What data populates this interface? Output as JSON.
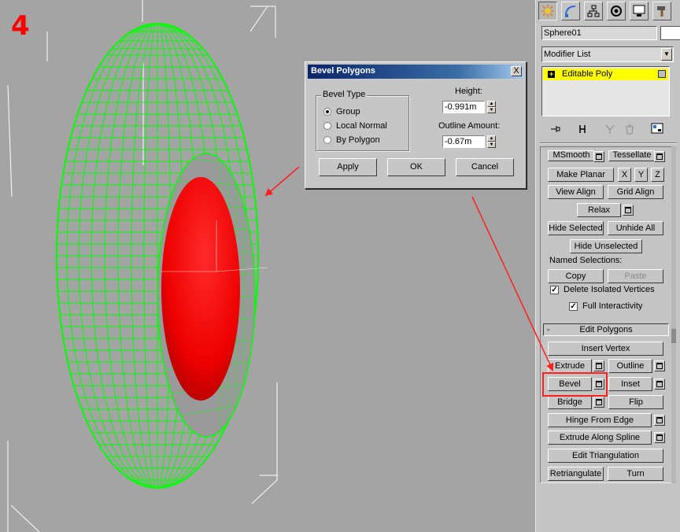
{
  "step_number": "4",
  "dialog": {
    "title": "Bevel Polygons",
    "close": "X",
    "bevel_type_label": "Bevel Type",
    "options": [
      "Group",
      "Local Normal",
      "By Polygon"
    ],
    "selected_option": "Group",
    "height_label": "Height:",
    "height_value": "-0.991m",
    "outline_label": "Outline Amount:",
    "outline_value": "-0.67m",
    "apply": "Apply",
    "ok": "OK",
    "cancel": "Cancel"
  },
  "command_panel": {
    "tabs": [
      "create-icon",
      "modify-icon",
      "hierarchy-icon",
      "motion-icon",
      "display-icon",
      "utilities-icon"
    ],
    "active_tab": "create-icon",
    "object_name": "Sphere01",
    "modifier_list": "Modifier List",
    "stack_item": "Editable Poly",
    "stack_item_plus": "+",
    "buttons": {
      "msmooth": "MSmooth",
      "tessellate": "Tessellate",
      "make_planar": "Make Planar",
      "x": "X",
      "y": "Y",
      "z": "Z",
      "view_align": "View Align",
      "grid_align": "Grid Align",
      "relax": "Relax",
      "hide_selected": "Hide Selected",
      "unhide_all": "Unhide All",
      "hide_unselected": "Hide Unselected",
      "copy": "Copy",
      "paste": "Paste",
      "insert_vertex": "Insert Vertex",
      "extrude": "Extrude",
      "outline": "Outline",
      "bevel": "Bevel",
      "inset": "Inset",
      "bridge": "Bridge",
      "flip": "Flip",
      "hinge_from_edge": "Hinge From Edge",
      "extrude_along_spline": "Extrude Along Spline",
      "edit_triangulation": "Edit Triangulation",
      "retriangulate": "Retriangulate",
      "turn": "Turn"
    },
    "named_selections_label": "Named Selections:",
    "delete_isolated_label": "Delete Isolated Vertices",
    "delete_isolated_checked": true,
    "full_interactivity_label": "Full Interactivity",
    "full_interactivity_checked": true,
    "edit_polygons_rollout": "Edit Polygons",
    "rollout_minus": "-",
    "check_mark": "✓"
  },
  "colors": {
    "wireframe": "#00ff00",
    "selected_faces": "#ff0000",
    "annotation": "#ff2020",
    "viewport_bg": "#a4a4a4",
    "stack_highlight": "#ffff00"
  }
}
